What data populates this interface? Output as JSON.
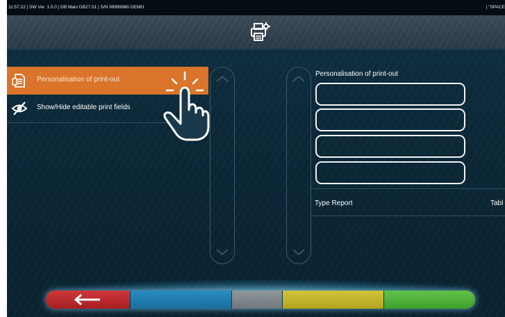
{
  "status_bar": {
    "left_text": "11:57:22  |  SW Ver. 1.0.0  |  DB Main DB27.01  |  S/N 99999980 DEMO",
    "right_text": "|  \"SPACE"
  },
  "header": {
    "icon": "printer-settings-icon"
  },
  "menu": {
    "items": [
      {
        "label": "Personalisation of print-out",
        "icon": "print-document-icon",
        "active": true
      },
      {
        "label": "Show/Hide editable print fields",
        "icon": "eye-slash-icon",
        "active": false
      }
    ]
  },
  "right_panel": {
    "title": "Personalisation of print-out",
    "fields": [
      "",
      "",
      "",
      ""
    ],
    "type_label": "Type Report",
    "type_value": "Tabl"
  },
  "bottom_bar": {
    "back_icon": "arrow-left-icon",
    "colors": {
      "back": "#c0292c",
      "blue": "#2380b3",
      "grey": "#7f878c",
      "yellow": "#c6b72e",
      "green": "#52b23c"
    }
  },
  "overlay": {
    "icon": "tap-hand-icon"
  }
}
